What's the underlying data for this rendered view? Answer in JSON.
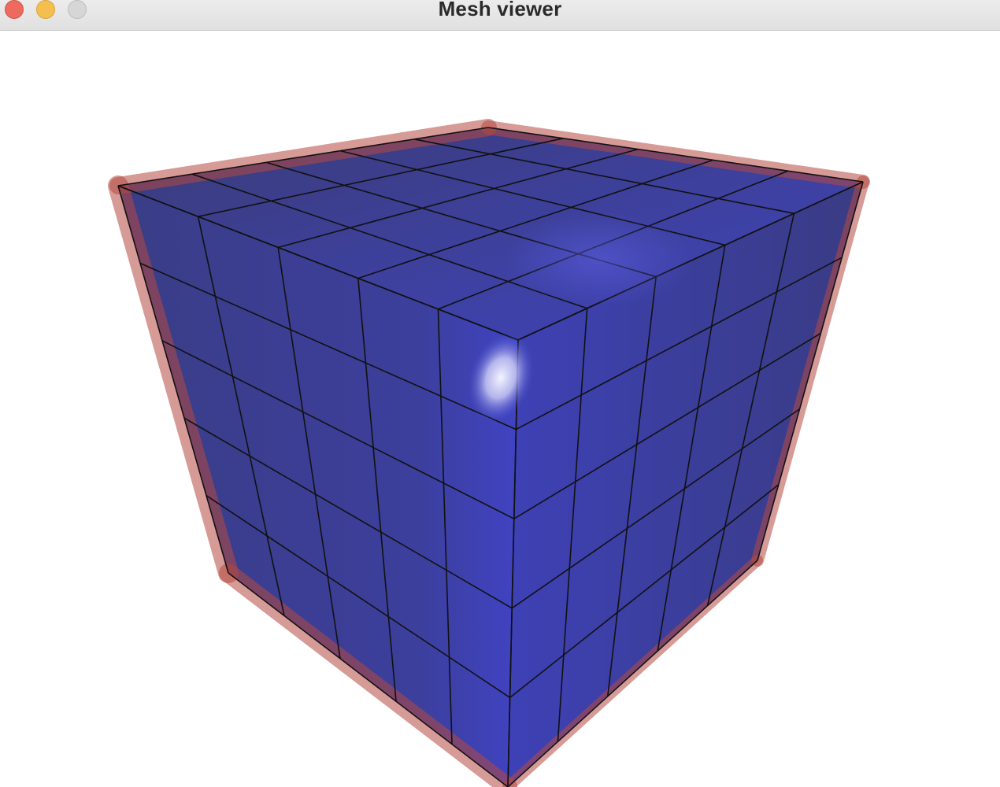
{
  "window": {
    "title": "Mesh viewer"
  },
  "titlebar_buttons": [
    {
      "name": "close",
      "color": "#ee6a5e"
    },
    {
      "name": "minimize",
      "color": "#f5bf4f"
    },
    {
      "name": "zoom",
      "color": "#d6d6d6"
    }
  ],
  "mesh": {
    "shape": "cube",
    "grid_divisions": 5,
    "face_color": "#3b3fa8",
    "edge_tint_color": "#b5493f",
    "wireframe_color": "#111111",
    "specular_color": "#e6e6ff"
  }
}
